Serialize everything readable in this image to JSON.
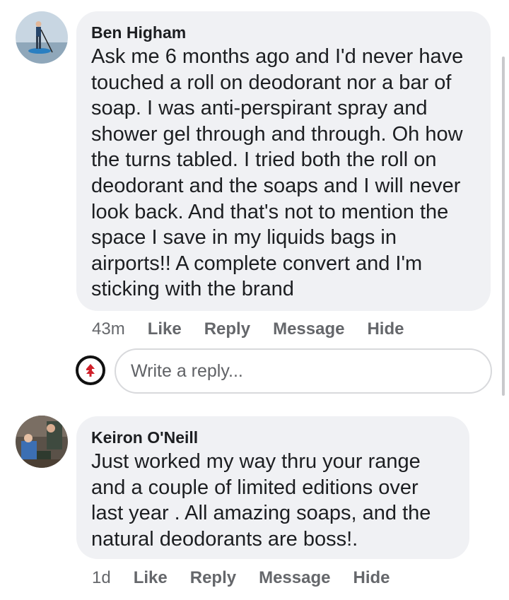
{
  "comments": [
    {
      "author": "Ben Higham",
      "text": "Ask me 6 months ago and I'd never have touched a roll on deodorant nor a bar of soap. I was anti-perspirant spray and shower gel through and through. Oh how the turns tabled. I tried both the roll on deodorant and the soaps and I will never look back. And that's not to mention the space I save in my liquids bags in airports!! A complete convert and I'm sticking with the brand",
      "time": "43m",
      "actions": {
        "like": "Like",
        "reply": "Reply",
        "message": "Message",
        "hide": "Hide"
      }
    },
    {
      "author": "Keiron O'Neill",
      "text": "Just worked my way thru your range and a couple of limited editions over last year . All amazing soaps, and the natural deodorants are boss!.",
      "time": "1d",
      "actions": {
        "like": "Like",
        "reply": "Reply",
        "message": "Message",
        "hide": "Hide"
      }
    }
  ],
  "reply_box": {
    "placeholder": "Write a reply...",
    "value": ""
  },
  "colors": {
    "bubble": "#f0f1f4",
    "secondary_text": "#65676b",
    "brand_icon": "#d0202a"
  }
}
